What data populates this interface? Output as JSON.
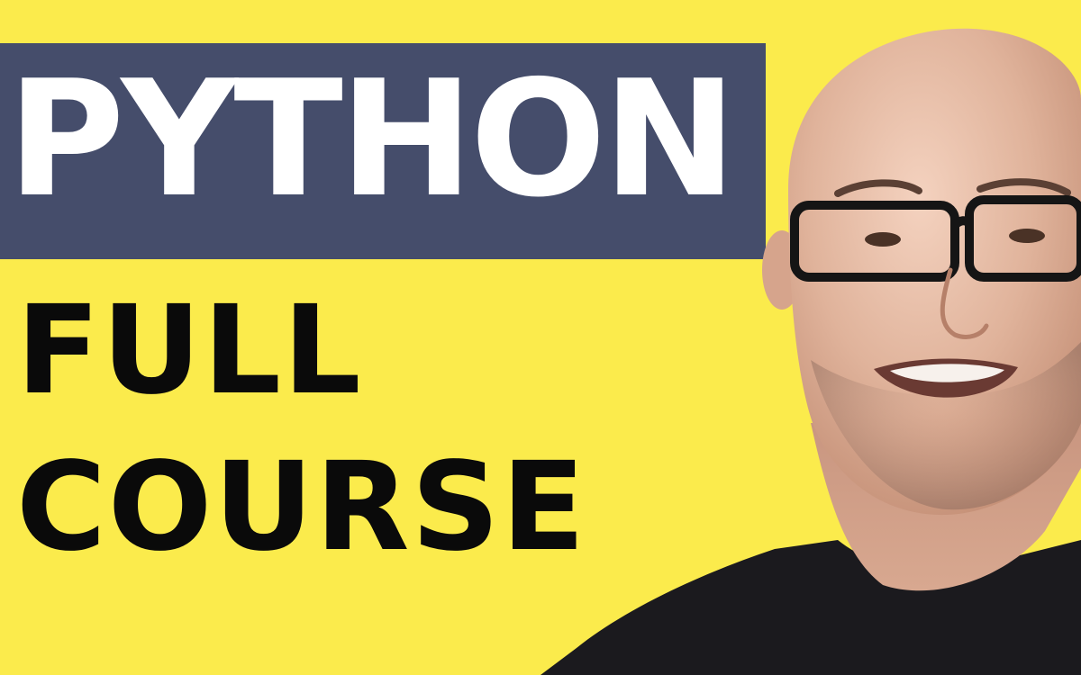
{
  "thumbnail": {
    "title": "PYTHON",
    "subtitle_line1": "FULL",
    "subtitle_line2": "COURSE"
  },
  "colors": {
    "background": "#fbeb4c",
    "title_bar": "#454d6b",
    "title_text": "#ffffff",
    "subtitle_text": "#0a0a0a",
    "shirt": "#1b1a1e",
    "skin": "#d9a88f"
  }
}
